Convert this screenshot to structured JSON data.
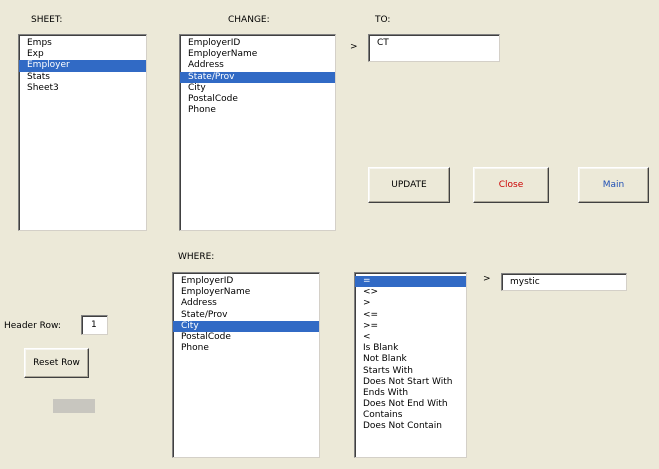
{
  "labels": {
    "sheet": "SHEET:",
    "change": "CHANGE:",
    "to": "TO:",
    "where": "WHERE:",
    "header_row": "Header Row:",
    "arrow_to": ">",
    "arrow_where": ">"
  },
  "sheet_list": {
    "items": [
      "Emps",
      "Exp",
      "Employer",
      "Stats",
      "Sheet3"
    ],
    "selected": "Employer"
  },
  "change_list": {
    "items": [
      "EmployerID",
      "EmployerName",
      "Address",
      "State/Prov",
      "City",
      "PostalCode",
      "Phone"
    ],
    "selected": "State/Prov"
  },
  "where_list": {
    "items": [
      "EmployerID",
      "EmployerName",
      "Address",
      "State/Prov",
      "City",
      "PostalCode",
      "Phone"
    ],
    "selected": "City"
  },
  "operator_list": {
    "items": [
      "=",
      "<>",
      ">",
      "<=",
      ">=",
      "<",
      "Is Blank",
      "Not Blank",
      "Starts With",
      "Does Not Start With",
      "Ends With",
      "Does Not End With",
      "Contains",
      "Does Not Contain"
    ],
    "selected": "="
  },
  "to_value": "CT",
  "where_value": "mystic",
  "header_row_value": "1",
  "buttons": {
    "update": "UPDATE",
    "close": "Close",
    "main": "Main",
    "reset_row": "Reset Row"
  },
  "colors": {
    "background": "#ece9d8",
    "selection": "#316ac5",
    "close_text": "#cc0000",
    "main_text": "#1f4fb5"
  }
}
